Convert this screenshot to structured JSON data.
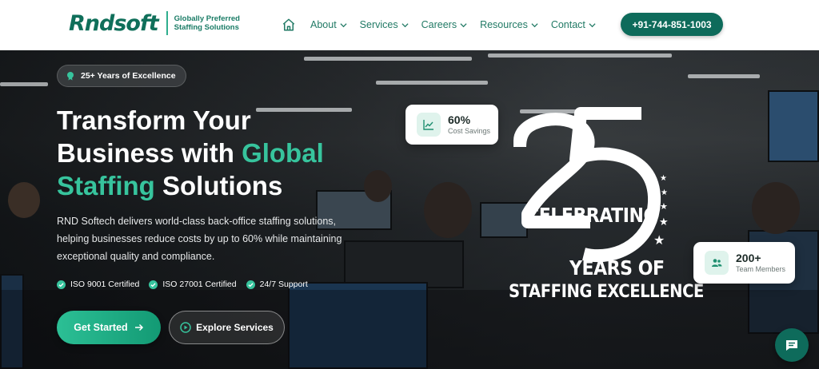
{
  "brand": {
    "logo_text": "Rndsoft",
    "tagline_line1": "Globally Preferred",
    "tagline_line2": "Staffing Solutions",
    "accent_color": "#0e6b5b",
    "highlight_color": "#37c49d"
  },
  "nav": {
    "home_icon": "home-icon",
    "items": [
      {
        "label": "About"
      },
      {
        "label": "Services"
      },
      {
        "label": "Careers"
      },
      {
        "label": "Resources"
      },
      {
        "label": "Contact"
      }
    ],
    "phone": "+91-744-851-1003"
  },
  "hero": {
    "badge": "25+ Years of Excellence",
    "headline_line1": "Transform Your",
    "headline_line2a": "Business with ",
    "headline_line2b": "Global",
    "headline_line3a": "Staffing",
    "headline_line3b": " Solutions",
    "description": "RND Softech delivers world-class back-office staffing solutions, helping businesses reduce costs by up to 60% while maintaining exceptional quality and compliance.",
    "certs": [
      {
        "label": "ISO 9001 Certified"
      },
      {
        "label": "ISO 27001 Certified"
      },
      {
        "label": "24/7 Support"
      }
    ],
    "primary_button": "Get Started",
    "secondary_button": "Explore Services"
  },
  "stats": [
    {
      "value": "60%",
      "label": "Cost Savings",
      "icon": "trend-up-icon"
    },
    {
      "value": "200+",
      "label": "Team Members",
      "icon": "users-icon"
    }
  ],
  "emblem": {
    "number": "25",
    "line1": "CELEBRATING",
    "line2": "YEARS OF",
    "line3": "STAFFING EXCELLENCE"
  },
  "chat": {
    "icon": "chat-icon"
  }
}
